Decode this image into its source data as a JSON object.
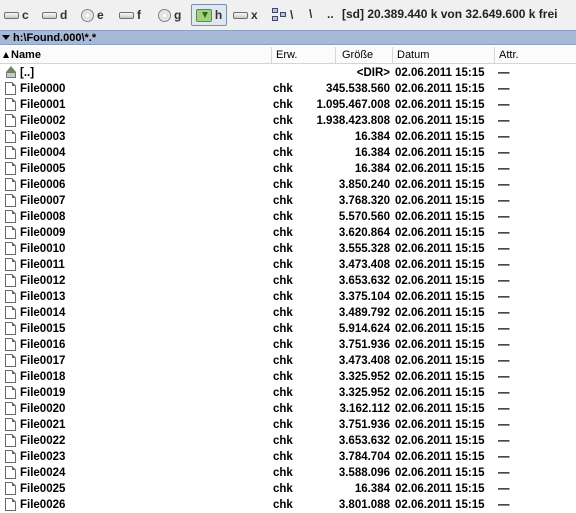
{
  "drivebar": {
    "drives": [
      {
        "letter": "c",
        "icon": "hard-drive-icon"
      },
      {
        "letter": "d",
        "icon": "hard-drive-icon"
      },
      {
        "letter": "e",
        "icon": "cd-drive-icon"
      },
      {
        "letter": "f",
        "icon": "hard-drive-icon"
      },
      {
        "letter": "g",
        "icon": "cd-drive-icon"
      },
      {
        "letter": "h",
        "icon": "usb-drive-icon",
        "active": true
      },
      {
        "letter": "x",
        "icon": "hard-drive-icon"
      }
    ],
    "network_label": "\\",
    "root_button": "\\",
    "parent_button": "..",
    "free_space": "[sd]  20.389.440 k von 32.649.600 k frei"
  },
  "pathbar": {
    "path": "h:\\Found.000\\*.*"
  },
  "columns": {
    "name": "Name",
    "ext": "Erw.",
    "size": "Größe",
    "date": "Datum",
    "attr": "Attr."
  },
  "files": [
    {
      "name": "[..]",
      "ext": "",
      "size": "<DIR>",
      "date": "02.06.2011 15:15",
      "attr": "—",
      "up": true
    },
    {
      "name": "File0000",
      "ext": "chk",
      "size": "345.538.560",
      "date": "02.06.2011 15:15",
      "attr": "—"
    },
    {
      "name": "File0001",
      "ext": "chk",
      "size": "1.095.467.008",
      "date": "02.06.2011 15:15",
      "attr": "—"
    },
    {
      "name": "File0002",
      "ext": "chk",
      "size": "1.938.423.808",
      "date": "02.06.2011 15:15",
      "attr": "—"
    },
    {
      "name": "File0003",
      "ext": "chk",
      "size": "16.384",
      "date": "02.06.2011 15:15",
      "attr": "—"
    },
    {
      "name": "File0004",
      "ext": "chk",
      "size": "16.384",
      "date": "02.06.2011 15:15",
      "attr": "—"
    },
    {
      "name": "File0005",
      "ext": "chk",
      "size": "16.384",
      "date": "02.06.2011 15:15",
      "attr": "—"
    },
    {
      "name": "File0006",
      "ext": "chk",
      "size": "3.850.240",
      "date": "02.06.2011 15:15",
      "attr": "—"
    },
    {
      "name": "File0007",
      "ext": "chk",
      "size": "3.768.320",
      "date": "02.06.2011 15:15",
      "attr": "—"
    },
    {
      "name": "File0008",
      "ext": "chk",
      "size": "5.570.560",
      "date": "02.06.2011 15:15",
      "attr": "—"
    },
    {
      "name": "File0009",
      "ext": "chk",
      "size": "3.620.864",
      "date": "02.06.2011 15:15",
      "attr": "—"
    },
    {
      "name": "File0010",
      "ext": "chk",
      "size": "3.555.328",
      "date": "02.06.2011 15:15",
      "attr": "—"
    },
    {
      "name": "File0011",
      "ext": "chk",
      "size": "3.473.408",
      "date": "02.06.2011 15:15",
      "attr": "—"
    },
    {
      "name": "File0012",
      "ext": "chk",
      "size": "3.653.632",
      "date": "02.06.2011 15:15",
      "attr": "—"
    },
    {
      "name": "File0013",
      "ext": "chk",
      "size": "3.375.104",
      "date": "02.06.2011 15:15",
      "attr": "—"
    },
    {
      "name": "File0014",
      "ext": "chk",
      "size": "3.489.792",
      "date": "02.06.2011 15:15",
      "attr": "—"
    },
    {
      "name": "File0015",
      "ext": "chk",
      "size": "5.914.624",
      "date": "02.06.2011 15:15",
      "attr": "—"
    },
    {
      "name": "File0016",
      "ext": "chk",
      "size": "3.751.936",
      "date": "02.06.2011 15:15",
      "attr": "—"
    },
    {
      "name": "File0017",
      "ext": "chk",
      "size": "3.473.408",
      "date": "02.06.2011 15:15",
      "attr": "—"
    },
    {
      "name": "File0018",
      "ext": "chk",
      "size": "3.325.952",
      "date": "02.06.2011 15:15",
      "attr": "—"
    },
    {
      "name": "File0019",
      "ext": "chk",
      "size": "3.325.952",
      "date": "02.06.2011 15:15",
      "attr": "—"
    },
    {
      "name": "File0020",
      "ext": "chk",
      "size": "3.162.112",
      "date": "02.06.2011 15:15",
      "attr": "—"
    },
    {
      "name": "File0021",
      "ext": "chk",
      "size": "3.751.936",
      "date": "02.06.2011 15:15",
      "attr": "—"
    },
    {
      "name": "File0022",
      "ext": "chk",
      "size": "3.653.632",
      "date": "02.06.2011 15:15",
      "attr": "—"
    },
    {
      "name": "File0023",
      "ext": "chk",
      "size": "3.784.704",
      "date": "02.06.2011 15:15",
      "attr": "—"
    },
    {
      "name": "File0024",
      "ext": "chk",
      "size": "3.588.096",
      "date": "02.06.2011 15:15",
      "attr": "—"
    },
    {
      "name": "File0025",
      "ext": "chk",
      "size": "16.384",
      "date": "02.06.2011 15:15",
      "attr": "—"
    },
    {
      "name": "File0026",
      "ext": "chk",
      "size": "3.801.088",
      "date": "02.06.2011 15:15",
      "attr": "—"
    }
  ]
}
